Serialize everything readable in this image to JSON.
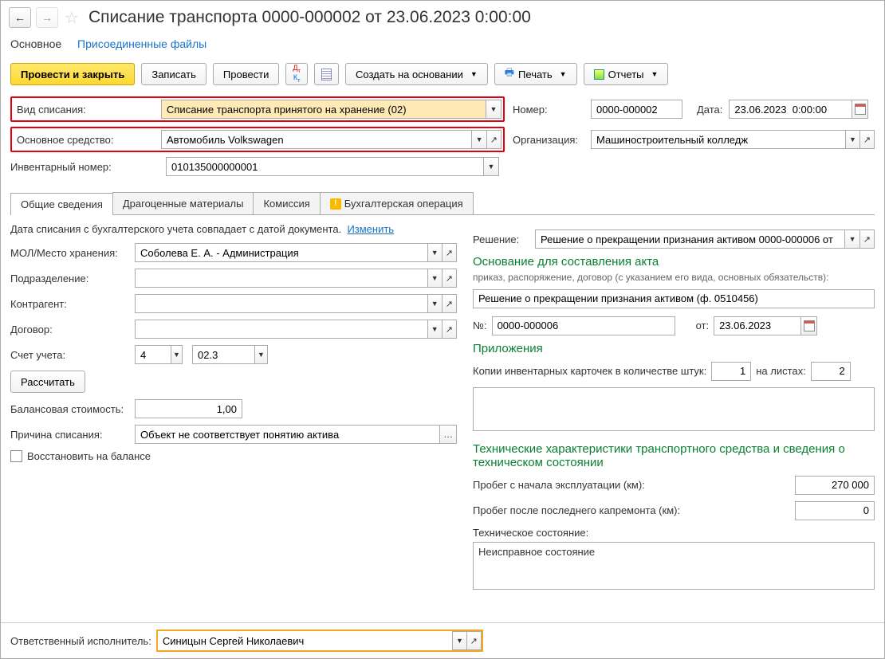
{
  "title": "Списание транспорта 0000-000002 от 23.06.2023 0:00:00",
  "navtabs": {
    "main": "Основное",
    "files": "Присоединенные файлы"
  },
  "toolbar": {
    "post_close": "Провести и закрыть",
    "save": "Записать",
    "post": "Провести",
    "create_on": "Создать на основании",
    "print": "Печать",
    "reports": "Отчеты"
  },
  "fields": {
    "writeoff_type_lbl": "Вид списания:",
    "writeoff_type": "Списание транспорта принятого на хранение (02)",
    "asset_lbl": "Основное средство:",
    "asset": "Автомобиль Volkswagen",
    "inv_lbl": "Инвентарный номер:",
    "inv": "010135000000001",
    "number_lbl": "Номер:",
    "number": "0000-000002",
    "date_lbl": "Дата:",
    "date": "23.06.2023  0:00:00",
    "org_lbl": "Организация:",
    "org": "Машиностроительный колледж"
  },
  "tabs": {
    "general": "Общие сведения",
    "precious": "Драгоценные материалы",
    "commission": "Комиссия",
    "acc": "Бухгалтерская операция"
  },
  "general": {
    "info": "Дата списания с бухгалтерского учета совпадает с датой документа.",
    "change": "Изменить",
    "mol_lbl": "МОЛ/Место хранения:",
    "mol": "Соболева Е. А. - Администрация",
    "dept_lbl": "Подразделение:",
    "dept": "",
    "counterparty_lbl": "Контрагент:",
    "counterparty": "",
    "contract_lbl": "Договор:",
    "contract": "",
    "account_lbl": "Счет учета:",
    "account1": "4",
    "account2": "02.3",
    "calc": "Рассчитать",
    "balance_lbl": "Балансовая стоимость:",
    "balance": "1,00",
    "reason_lbl": "Причина списания:",
    "reason": "Объект не соответствует понятию актива",
    "restore": "Восстановить на балансе"
  },
  "right": {
    "decision_lbl": "Решение:",
    "decision": "Решение о прекращении признания активом 0000-000006 от",
    "basis_h": "Основание для составления акта",
    "basis_desc": "приказ, распоряжение, договор (с указанием его вида, основных обязательств):",
    "basis": "Решение о прекращении признания активом (ф. 0510456)",
    "num_lbl": "№:",
    "num": "0000-000006",
    "from_lbl": "от:",
    "from": "23.06.2023",
    "appendix_h": "Приложения",
    "copies_lbl": "Копии инвентарных карточек в количестве штук:",
    "copies": "1",
    "sheets_lbl": "на листах:",
    "sheets": "2",
    "tech_h": "Технические характеристики транспортного средства и сведения о техническом состоянии",
    "mileage_lbl": "Пробег с начала эксплуатации (км):",
    "mileage": "270 000",
    "mileage2_lbl": "Пробег после последнего капремонта (км):",
    "mileage2": "0",
    "condition_lbl": "Техническое состояние:",
    "condition": "Неисправное состояние"
  },
  "footer": {
    "lbl": "Ответственный исполнитель:",
    "val": "Синицын Сергей Николаевич"
  }
}
